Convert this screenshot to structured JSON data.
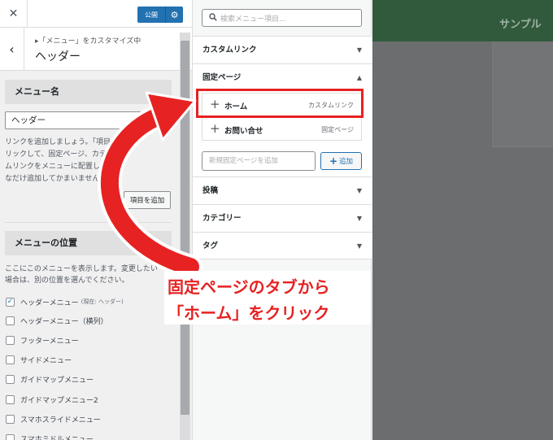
{
  "topbar": {
    "close_icon": "✕",
    "publish_label": "公開",
    "gear_icon": "⚙"
  },
  "section": {
    "back_icon": "‹",
    "breadcrumb": "▸「メニュー」をカスタマイズ中",
    "title": "ヘッダー"
  },
  "menu_name": {
    "heading": "メニュー名",
    "value": "ヘッダー",
    "help_lines": [
      "リンクを追加しましょう。「項目",
      "リックして、固定ページ、カテ",
      "ムリンクをメニューに配置し",
      "なだけ追加してかまいません。"
    ],
    "add_items_label": "項目を追加"
  },
  "menu_locations": {
    "heading": "メニューの位置",
    "desc_lines": [
      "ここにこのメニューを表示します。変更したい",
      "場合は、別の位置を選んでください。"
    ],
    "items": [
      {
        "label": "ヘッダーメニュー",
        "note": "(現在: ヘッダー)",
        "checked": true
      },
      {
        "label": "ヘッダーメニュー（横列）",
        "note": "",
        "checked": false
      },
      {
        "label": "フッターメニュー",
        "note": "",
        "checked": false
      },
      {
        "label": "サイドメニュー",
        "note": "",
        "checked": false
      },
      {
        "label": "ガイドマップメニュー",
        "note": "",
        "checked": false
      },
      {
        "label": "ガイドマップメニュー2",
        "note": "",
        "checked": false
      },
      {
        "label": "スマホスライドメニュー",
        "note": "",
        "checked": false
      },
      {
        "label": "スマホミドルメニュー",
        "note": "",
        "checked": false
      }
    ]
  },
  "add_panel": {
    "search_placeholder": "検索メニュー項目...",
    "custom_link": "カスタムリンク",
    "fixed_page": "固定ページ",
    "pages": [
      {
        "title": "ホーム",
        "type": "カスタムリンク"
      },
      {
        "title": "お問い合せ",
        "type": "固定ページ"
      }
    ],
    "new_page_placeholder": "新規固定ページを追加",
    "add_button": "追加",
    "posts": "投稿",
    "categories": "カテゴリー",
    "tags": "タグ",
    "arrow_down": "▼",
    "arrow_up": "▲",
    "plus": "+"
  },
  "preview": {
    "site_title": "サンプル"
  },
  "annotation": {
    "line1": "固定ページのタブから",
    "line2": "「ホーム」をクリック",
    "color": "#e62222"
  }
}
